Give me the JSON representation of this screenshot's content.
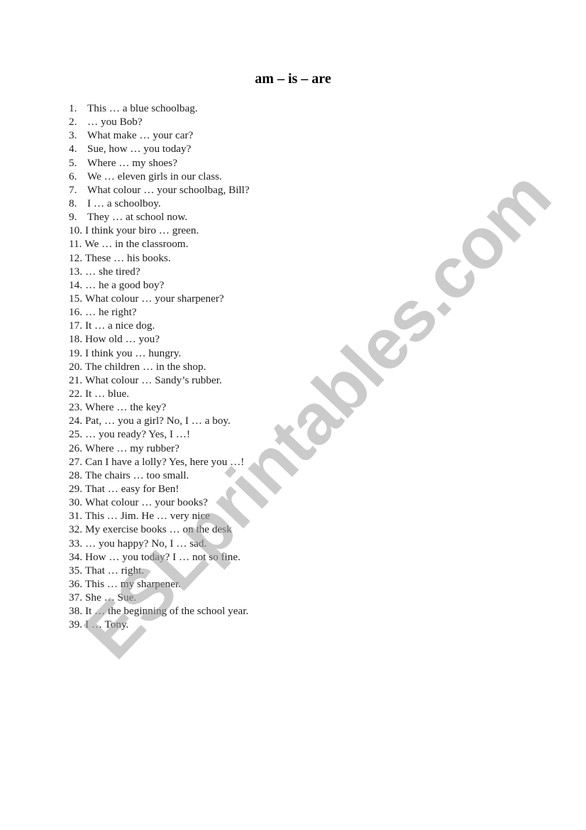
{
  "document": {
    "title": "am – is – are",
    "watermark": "ESLprintables.com",
    "exercises": [
      {
        "number": "1.",
        "text": "This … a blue schoolbag."
      },
      {
        "number": "2.",
        "text": "… you Bob?"
      },
      {
        "number": "3.",
        "text": "What make … your car?"
      },
      {
        "number": "4.",
        "text": "Sue, how … you today?"
      },
      {
        "number": "5.",
        "text": "Where … my shoes?"
      },
      {
        "number": "6.",
        "text": "We … eleven girls in our class."
      },
      {
        "number": "7.",
        "text": "What colour … your schoolbag, Bill?"
      },
      {
        "number": "8.",
        "text": "I … a schoolboy."
      },
      {
        "number": "9.",
        "text": "They … at school now."
      },
      {
        "number": "10.",
        "text": "I think your biro … green."
      },
      {
        "number": "11.",
        "text": "We … in the classroom."
      },
      {
        "number": "12.",
        "text": "These … his books."
      },
      {
        "number": "13.",
        "text": "… she tired?"
      },
      {
        "number": "14.",
        "text": "… he a good boy?"
      },
      {
        "number": "15.",
        "text": "What colour … your sharpener?"
      },
      {
        "number": "16.",
        "text": "… he right?"
      },
      {
        "number": "17.",
        "text": "It … a nice dog."
      },
      {
        "number": "18.",
        "text": "How old … you?"
      },
      {
        "number": "19.",
        "text": "I think you … hungry."
      },
      {
        "number": "20.",
        "text": "The children … in the shop."
      },
      {
        "number": "21.",
        "text": "What colour … Sandy’s rubber."
      },
      {
        "number": "22.",
        "text": "It … blue."
      },
      {
        "number": "23.",
        "text": "Where … the key?"
      },
      {
        "number": "24.",
        "text": "Pat, … you a girl? No, I … a boy."
      },
      {
        "number": "25.",
        "text": "… you ready? Yes, I …!"
      },
      {
        "number": "26.",
        "text": "Where … my rubber?"
      },
      {
        "number": "27.",
        "text": "Can I have a lolly? Yes, here you …!"
      },
      {
        "number": "28.",
        "text": "The chairs … too small."
      },
      {
        "number": "29.",
        "text": "That … easy for Ben!"
      },
      {
        "number": "30.",
        "text": "What colour … your books?"
      },
      {
        "number": "31.",
        "text": "This … Jim. He … very nice"
      },
      {
        "number": "32.",
        "text": "My exercise books … on the desk"
      },
      {
        "number": "33.",
        "text": "… you happy? No, I … sad."
      },
      {
        "number": "34.",
        "text": "How … you today? I … not so fine."
      },
      {
        "number": "35.",
        "text": "That … right."
      },
      {
        "number": "36.",
        "text": "This … my sharpener."
      },
      {
        "number": "37.",
        "text": "She … Sue."
      },
      {
        "number": "38.",
        "text": "It … the beginning of the school year."
      },
      {
        "number": "39.",
        "text": "I … Tony."
      }
    ]
  }
}
